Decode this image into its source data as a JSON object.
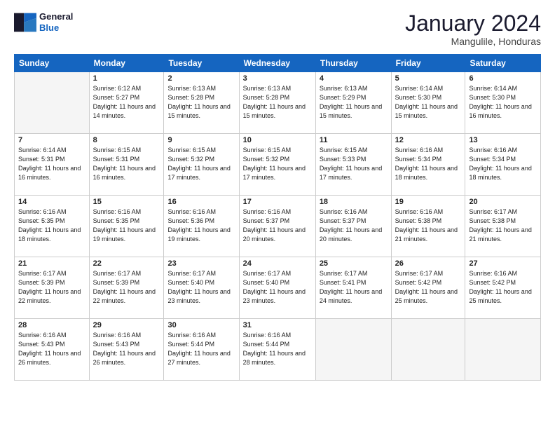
{
  "logo": {
    "line1": "General",
    "line2": "Blue"
  },
  "title": "January 2024",
  "location": "Mangulile, Honduras",
  "header": {
    "days": [
      "Sunday",
      "Monday",
      "Tuesday",
      "Wednesday",
      "Thursday",
      "Friday",
      "Saturday"
    ]
  },
  "weeks": [
    [
      {
        "day": "",
        "info": ""
      },
      {
        "day": "1",
        "info": "Sunrise: 6:12 AM\nSunset: 5:27 PM\nDaylight: 11 hours\nand 14 minutes."
      },
      {
        "day": "2",
        "info": "Sunrise: 6:13 AM\nSunset: 5:28 PM\nDaylight: 11 hours\nand 15 minutes."
      },
      {
        "day": "3",
        "info": "Sunrise: 6:13 AM\nSunset: 5:28 PM\nDaylight: 11 hours\nand 15 minutes."
      },
      {
        "day": "4",
        "info": "Sunrise: 6:13 AM\nSunset: 5:29 PM\nDaylight: 11 hours\nand 15 minutes."
      },
      {
        "day": "5",
        "info": "Sunrise: 6:14 AM\nSunset: 5:30 PM\nDaylight: 11 hours\nand 15 minutes."
      },
      {
        "day": "6",
        "info": "Sunrise: 6:14 AM\nSunset: 5:30 PM\nDaylight: 11 hours\nand 16 minutes."
      }
    ],
    [
      {
        "day": "7",
        "info": "Sunrise: 6:14 AM\nSunset: 5:31 PM\nDaylight: 11 hours\nand 16 minutes."
      },
      {
        "day": "8",
        "info": "Sunrise: 6:15 AM\nSunset: 5:31 PM\nDaylight: 11 hours\nand 16 minutes."
      },
      {
        "day": "9",
        "info": "Sunrise: 6:15 AM\nSunset: 5:32 PM\nDaylight: 11 hours\nand 17 minutes."
      },
      {
        "day": "10",
        "info": "Sunrise: 6:15 AM\nSunset: 5:32 PM\nDaylight: 11 hours\nand 17 minutes."
      },
      {
        "day": "11",
        "info": "Sunrise: 6:15 AM\nSunset: 5:33 PM\nDaylight: 11 hours\nand 17 minutes."
      },
      {
        "day": "12",
        "info": "Sunrise: 6:16 AM\nSunset: 5:34 PM\nDaylight: 11 hours\nand 18 minutes."
      },
      {
        "day": "13",
        "info": "Sunrise: 6:16 AM\nSunset: 5:34 PM\nDaylight: 11 hours\nand 18 minutes."
      }
    ],
    [
      {
        "day": "14",
        "info": "Sunrise: 6:16 AM\nSunset: 5:35 PM\nDaylight: 11 hours\nand 18 minutes."
      },
      {
        "day": "15",
        "info": "Sunrise: 6:16 AM\nSunset: 5:35 PM\nDaylight: 11 hours\nand 19 minutes."
      },
      {
        "day": "16",
        "info": "Sunrise: 6:16 AM\nSunset: 5:36 PM\nDaylight: 11 hours\nand 19 minutes."
      },
      {
        "day": "17",
        "info": "Sunrise: 6:16 AM\nSunset: 5:37 PM\nDaylight: 11 hours\nand 20 minutes."
      },
      {
        "day": "18",
        "info": "Sunrise: 6:16 AM\nSunset: 5:37 PM\nDaylight: 11 hours\nand 20 minutes."
      },
      {
        "day": "19",
        "info": "Sunrise: 6:16 AM\nSunset: 5:38 PM\nDaylight: 11 hours\nand 21 minutes."
      },
      {
        "day": "20",
        "info": "Sunrise: 6:17 AM\nSunset: 5:38 PM\nDaylight: 11 hours\nand 21 minutes."
      }
    ],
    [
      {
        "day": "21",
        "info": "Sunrise: 6:17 AM\nSunset: 5:39 PM\nDaylight: 11 hours\nand 22 minutes."
      },
      {
        "day": "22",
        "info": "Sunrise: 6:17 AM\nSunset: 5:39 PM\nDaylight: 11 hours\nand 22 minutes."
      },
      {
        "day": "23",
        "info": "Sunrise: 6:17 AM\nSunset: 5:40 PM\nDaylight: 11 hours\nand 23 minutes."
      },
      {
        "day": "24",
        "info": "Sunrise: 6:17 AM\nSunset: 5:40 PM\nDaylight: 11 hours\nand 23 minutes."
      },
      {
        "day": "25",
        "info": "Sunrise: 6:17 AM\nSunset: 5:41 PM\nDaylight: 11 hours\nand 24 minutes."
      },
      {
        "day": "26",
        "info": "Sunrise: 6:17 AM\nSunset: 5:42 PM\nDaylight: 11 hours\nand 25 minutes."
      },
      {
        "day": "27",
        "info": "Sunrise: 6:16 AM\nSunset: 5:42 PM\nDaylight: 11 hours\nand 25 minutes."
      }
    ],
    [
      {
        "day": "28",
        "info": "Sunrise: 6:16 AM\nSunset: 5:43 PM\nDaylight: 11 hours\nand 26 minutes."
      },
      {
        "day": "29",
        "info": "Sunrise: 6:16 AM\nSunset: 5:43 PM\nDaylight: 11 hours\nand 26 minutes."
      },
      {
        "day": "30",
        "info": "Sunrise: 6:16 AM\nSunset: 5:44 PM\nDaylight: 11 hours\nand 27 minutes."
      },
      {
        "day": "31",
        "info": "Sunrise: 6:16 AM\nSunset: 5:44 PM\nDaylight: 11 hours\nand 28 minutes."
      },
      {
        "day": "",
        "info": ""
      },
      {
        "day": "",
        "info": ""
      },
      {
        "day": "",
        "info": ""
      }
    ]
  ]
}
